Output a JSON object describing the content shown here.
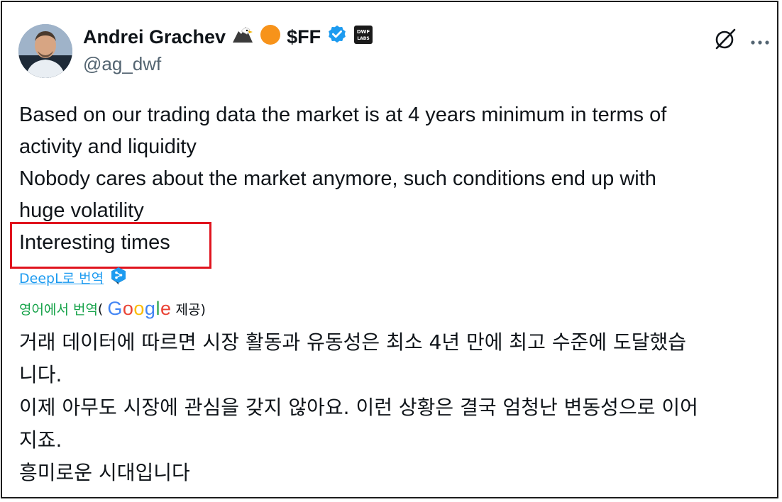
{
  "author": {
    "display_name": "Andrei Grachev",
    "ticker": "$FF",
    "handle": "@ag_dwf",
    "badges": [
      "eagle-icon",
      "orange-circle-icon",
      "verified-icon",
      "dwf-labs-logo"
    ],
    "dwf_logo_text": [
      "DWF",
      "LABS"
    ]
  },
  "tweet": {
    "lines": [
      "Based on our trading data the market is at 4 years minimum in terms of",
      "activity and liquidity",
      "Nobody cares about the market anymore, such conditions end up with",
      "huge volatility",
      "Interesting times"
    ],
    "highlighted_line": "Interesting times"
  },
  "translation": {
    "deepl_link": "DeepL로 번역",
    "google_prefix": "영어에서 번역",
    "open_paren": "(",
    "google_logo_letters": [
      "G",
      "o",
      "o",
      "g",
      "l",
      "e"
    ],
    "google_suffix": "제공)",
    "lines": [
      "거래 데이터에 따르면 시장 활동과 유동성은 최소 4년 만에 최고 수준에 도달했습",
      "니다.",
      "이제 아무도 시장에 관심을 갖지 않아요. 이런 상황은 결국 엄청난 변동성으로 이어",
      "지죠.",
      "흥미로운 시대입니다"
    ]
  },
  "colors": {
    "verified": "#1d9bf0",
    "orange_badge": "#f7931a",
    "highlight_border": "#e0141e",
    "link": "#1d9bf0",
    "translated_label": "#17a34a"
  },
  "actions": [
    "grok-icon",
    "more-icon"
  ]
}
